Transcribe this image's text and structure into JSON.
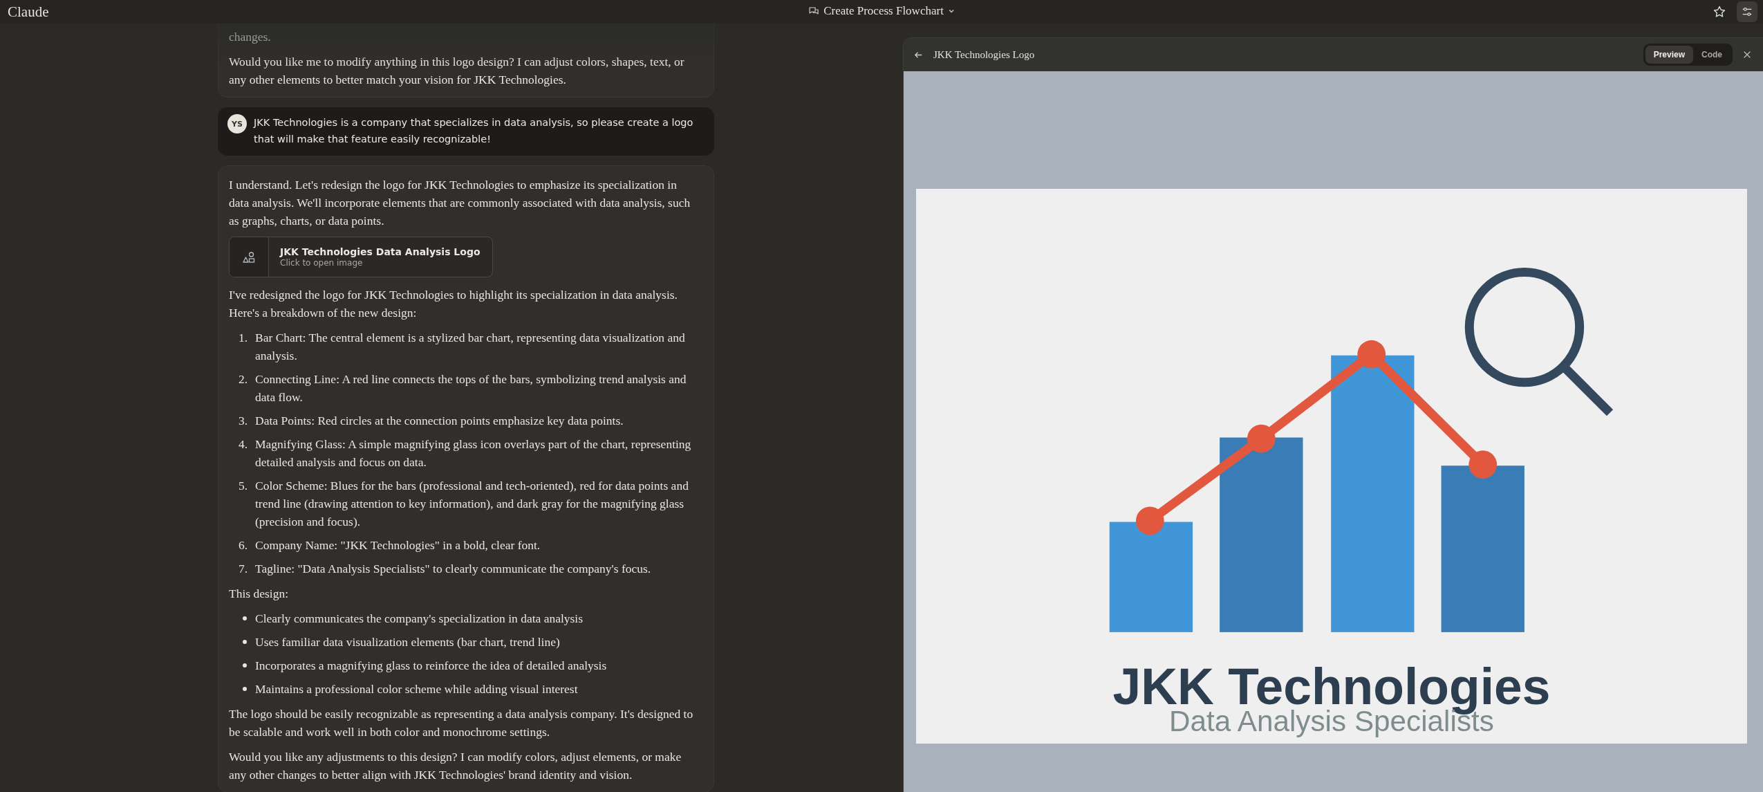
{
  "app": {
    "name": "Claude"
  },
  "header": {
    "title": "Create Process Flowchart"
  },
  "messages": [
    {
      "kind": "assistant",
      "blocks": [
        {
          "kind": "paragraph",
          "text": "changes."
        },
        {
          "kind": "paragraph",
          "text": "Would you like me to modify anything in this logo design? I can adjust colors, shapes, text, or any other elements to better match your vision for JKK Technologies."
        }
      ]
    },
    {
      "kind": "user",
      "initials": "YS",
      "text": "JKK Technologies is a company that specializes in data analysis, so please create a logo that will make that feature easily recognizable!"
    },
    {
      "kind": "assistant",
      "blocks": [
        {
          "kind": "paragraph",
          "text": "I understand. Let's redesign the logo for JKK Technologies to emphasize its specialization in data analysis. We'll incorporate elements that are commonly associated with data analysis, such as graphs, charts, or data points."
        },
        {
          "kind": "artifact",
          "title": "JKK Technologies Data Analysis Logo",
          "subtitle": "Click to open image"
        },
        {
          "kind": "paragraph",
          "text": "I've redesigned the logo for JKK Technologies to highlight its specialization in data analysis. Here's a breakdown of the new design:"
        },
        {
          "kind": "ordered_list",
          "items": [
            {
              "number": "1.",
              "text": "Bar Chart: The central element is a stylized bar chart, representing data visualization and analysis."
            },
            {
              "number": "2.",
              "text": "Connecting Line: A red line connects the tops of the bars, symbolizing trend analysis and data flow."
            },
            {
              "number": "3.",
              "text": "Data Points: Red circles at the connection points emphasize key data points."
            },
            {
              "number": "4.",
              "text": "Magnifying Glass: A simple magnifying glass icon overlays part of the chart, representing detailed analysis and focus on data."
            },
            {
              "number": "5.",
              "text": "Color Scheme: Blues for the bars (professional and tech-oriented), red for data points and trend line (drawing attention to key information), and dark gray for the magnifying glass (precision and focus)."
            },
            {
              "number": "6.",
              "text": "Company Name: \"JKK Technologies\" in a bold, clear font."
            },
            {
              "number": "7.",
              "text": "Tagline: \"Data Analysis Specialists\" to clearly communicate the company's focus."
            }
          ]
        },
        {
          "kind": "paragraph",
          "text": "This design:"
        },
        {
          "kind": "bullet_list",
          "items": [
            {
              "text": "Clearly communicates the company's specialization in data analysis"
            },
            {
              "text": "Uses familiar data visualization elements (bar chart, trend line)"
            },
            {
              "text": "Incorporates a magnifying glass to reinforce the idea of detailed analysis"
            },
            {
              "text": "Maintains a professional color scheme while adding visual interest"
            }
          ]
        },
        {
          "kind": "paragraph",
          "text": "The logo should be easily recognizable as representing a data analysis company. It's designed to be scalable and work well in both color and monochrome settings."
        },
        {
          "kind": "paragraph",
          "text": "Would you like any adjustments to this design? I can modify colors, adjust elements, or make any other changes to better align with JKK Technologies' brand identity and vision."
        }
      ]
    }
  ],
  "artifact_panel": {
    "title": "JKK Technologies Logo",
    "tabs": [
      {
        "label": "Preview",
        "selected": true
      },
      {
        "label": "Code",
        "selected": false
      }
    ],
    "logo": {
      "name": "JKK Technologies",
      "tagline": "Data Analysis Specialists"
    }
  }
}
